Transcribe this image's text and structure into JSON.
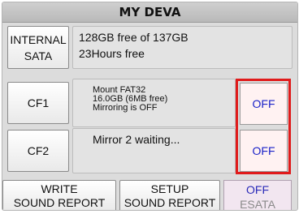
{
  "header": {
    "title": "MY DEVA"
  },
  "drives": [
    {
      "button_line1": "INTERNAL",
      "button_line2": "SATA",
      "info_line1": "128GB free of 137GB",
      "info_line2": "23Hours free"
    },
    {
      "button_label": "CF1",
      "info_line1": "Mount FAT32",
      "info_line2": "16.0GB (6MB free)",
      "info_line3": "Mirroring is OFF",
      "toggle_label": "OFF"
    },
    {
      "button_label": "CF2",
      "info_line1": "Mirror 2  waiting...",
      "toggle_label": "OFF"
    }
  ],
  "footer": {
    "write_line1": "WRITE",
    "write_line2": "SOUND REPORT",
    "setup_line1": "SETUP",
    "setup_line2": "SOUND REPORT",
    "esata_state": "OFF",
    "esata_label": "ESATA"
  },
  "colors": {
    "highlight_frame": "#e01b1b",
    "off_text": "#1a22c8",
    "esata_label": "#8a8a8a"
  }
}
